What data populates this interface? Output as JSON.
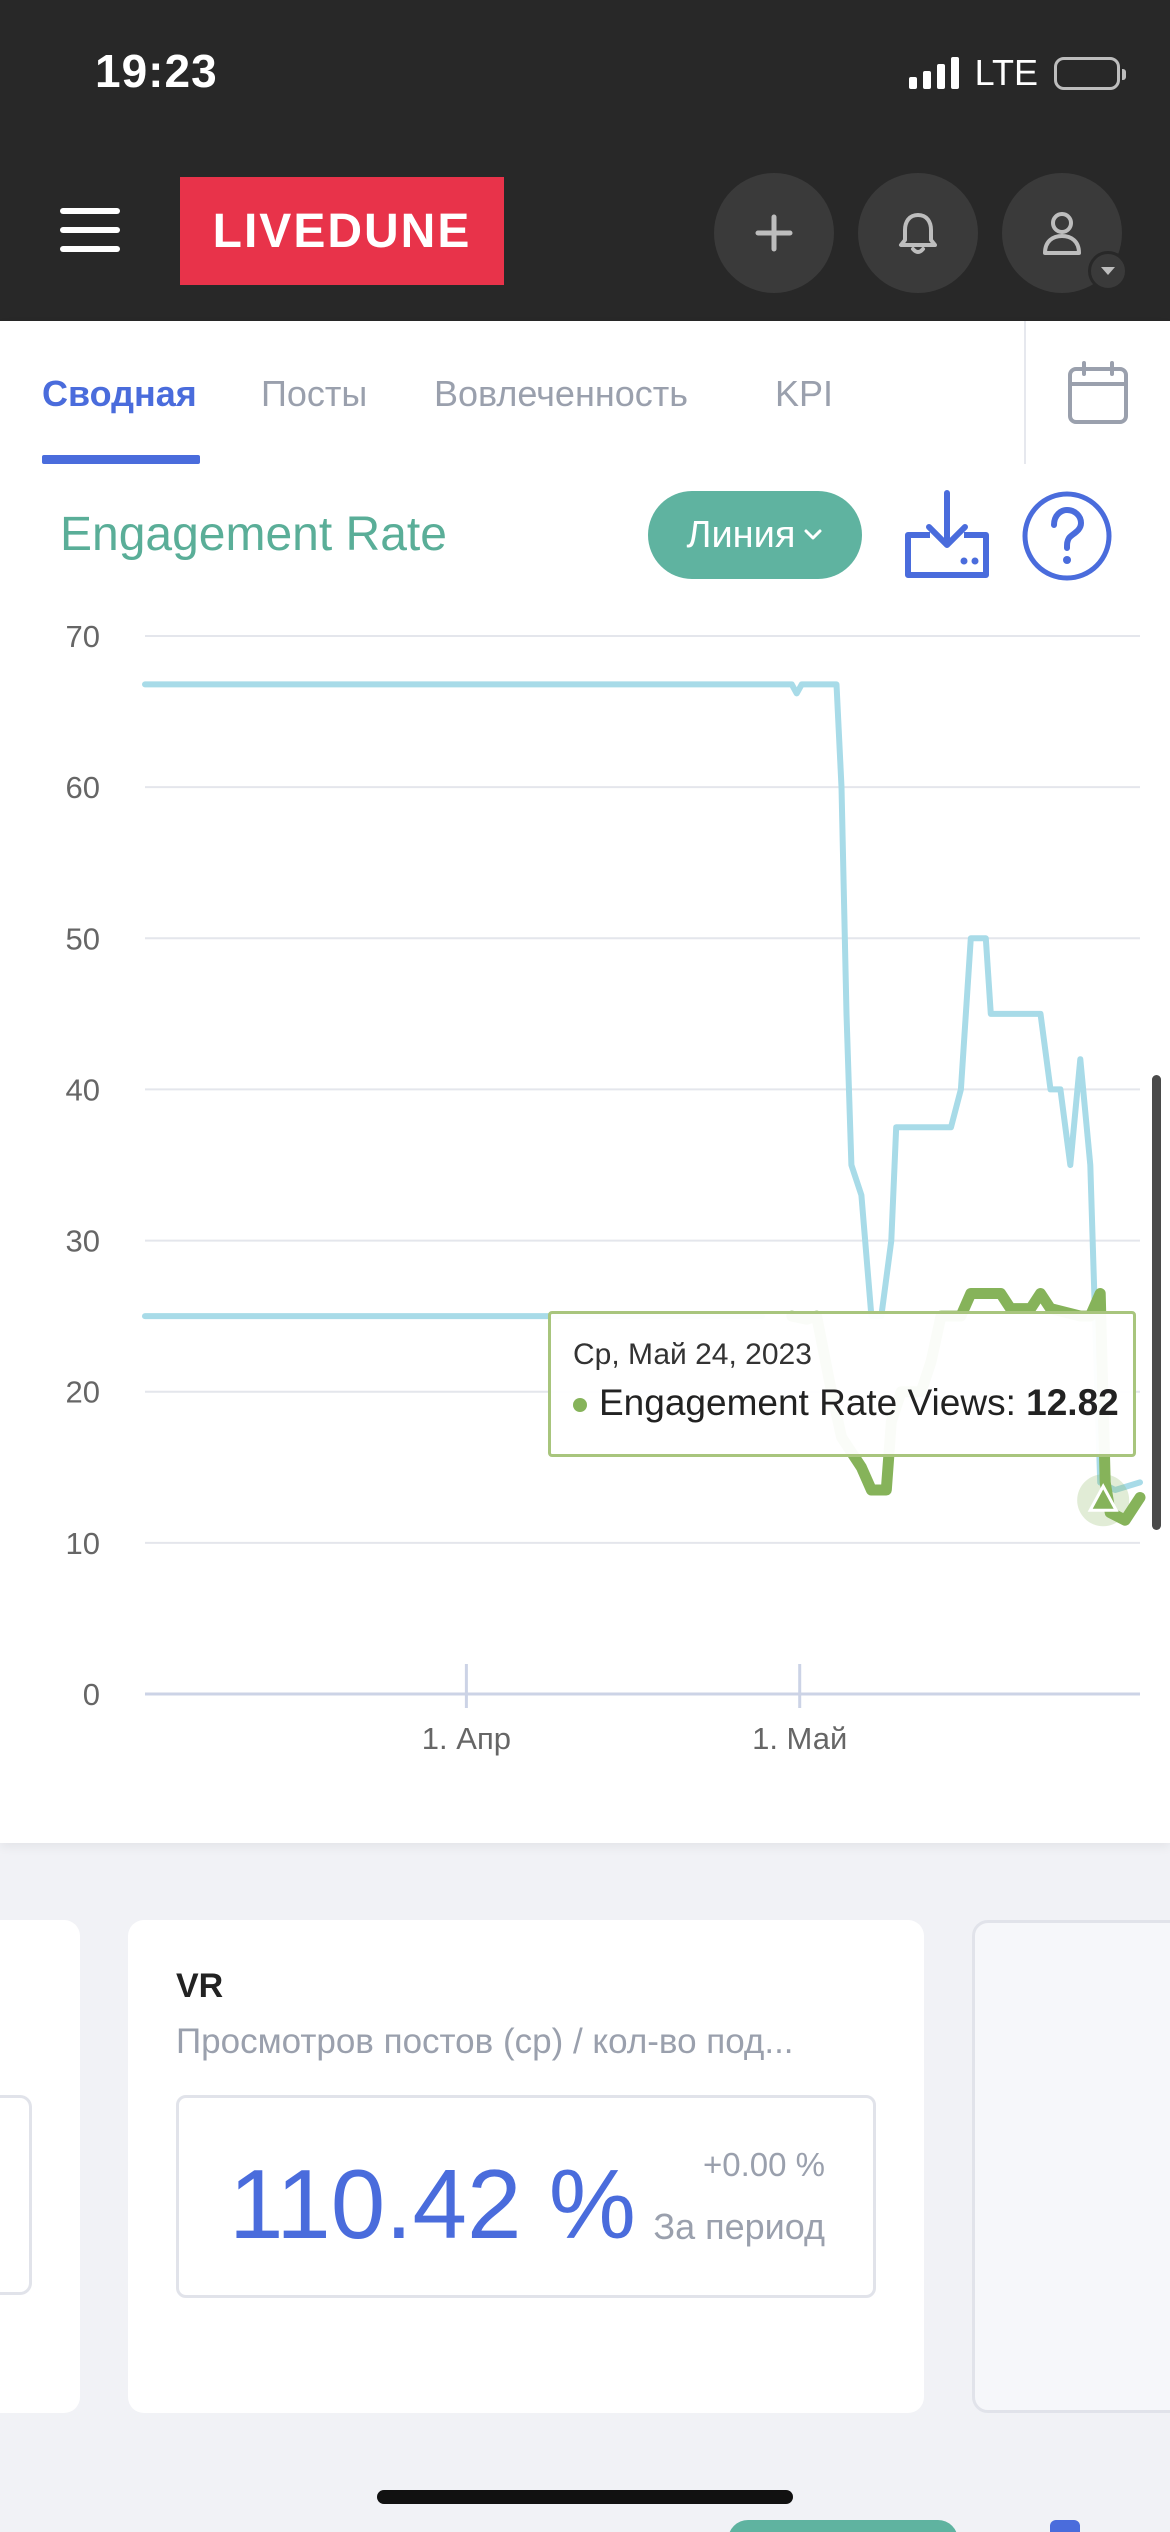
{
  "status_bar": {
    "time": "19:23",
    "network": "LTE"
  },
  "header": {
    "logo": "LIVEDUNE"
  },
  "tabs": [
    {
      "label": "Сводная",
      "active": true
    },
    {
      "label": "Посты",
      "active": false
    },
    {
      "label": "Вовлеченность",
      "active": false
    },
    {
      "label": "KPI",
      "active": false
    }
  ],
  "chart_panel": {
    "title": "Engagement Rate",
    "type_button": "Линия",
    "colors": {
      "series_1": "#a8dbe8",
      "series_2": "#86b35a",
      "accent": "#4a6cdc",
      "title": "#5aae98"
    }
  },
  "chart_data": {
    "type": "line",
    "ylim": [
      0,
      70
    ],
    "y_ticks": [
      "0",
      "10",
      "20",
      "30",
      "40",
      "50",
      "60",
      "70"
    ],
    "x_tick_labels": [
      "1. Апр",
      "1. Май"
    ],
    "grid": true,
    "series": [
      {
        "color": "#a8dbe8",
        "points": [
          [
            0,
            66.8
          ],
          [
            0.65,
            66.8
          ],
          [
            0.655,
            66.2
          ],
          [
            0.66,
            66.8
          ],
          [
            0.695,
            66.8
          ],
          [
            0.7,
            60
          ],
          [
            0.705,
            45
          ],
          [
            0.71,
            35
          ],
          [
            0.72,
            33
          ],
          [
            0.73,
            25
          ],
          [
            0.74,
            25
          ],
          [
            0.75,
            30
          ],
          [
            0.755,
            37.5
          ],
          [
            0.81,
            37.5
          ],
          [
            0.82,
            40
          ],
          [
            0.83,
            50
          ],
          [
            0.845,
            50
          ],
          [
            0.85,
            45
          ],
          [
            0.9,
            45
          ],
          [
            0.91,
            40
          ],
          [
            0.92,
            40
          ],
          [
            0.93,
            35
          ],
          [
            0.94,
            42
          ],
          [
            0.95,
            35
          ],
          [
            0.96,
            14
          ],
          [
            0.975,
            13.5
          ],
          [
            1.0,
            14
          ]
        ]
      },
      {
        "color": "#a8dbe8",
        "points": [
          [
            0,
            25
          ],
          [
            0.62,
            25
          ]
        ]
      },
      {
        "color": "#86b35a",
        "points": [
          [
            0.65,
            25
          ],
          [
            0.665,
            24.8
          ],
          [
            0.675,
            25
          ],
          [
            0.69,
            20
          ],
          [
            0.7,
            17
          ],
          [
            0.72,
            15
          ],
          [
            0.73,
            13.5
          ],
          [
            0.745,
            13.5
          ],
          [
            0.75,
            18
          ],
          [
            0.76,
            20
          ],
          [
            0.78,
            20
          ],
          [
            0.79,
            22
          ],
          [
            0.8,
            25
          ],
          [
            0.82,
            25
          ],
          [
            0.83,
            26.5
          ],
          [
            0.86,
            26.5
          ],
          [
            0.87,
            25.5
          ],
          [
            0.89,
            25.5
          ],
          [
            0.9,
            26.5
          ],
          [
            0.91,
            25.5
          ],
          [
            0.94,
            25
          ],
          [
            0.95,
            25
          ],
          [
            0.96,
            26.5
          ],
          [
            0.965,
            14
          ],
          [
            0.97,
            12
          ],
          [
            0.985,
            11.5
          ],
          [
            1.0,
            13
          ]
        ]
      }
    ],
    "tooltip": {
      "date": "Ср, Май 24, 2023",
      "series_label": "Engagement Rate Views:",
      "value": "12.82"
    }
  },
  "metric_card": {
    "title": "VR",
    "subtitle": "Просмотров постов (ср) / кол-во под...",
    "value": "110.42 %",
    "delta": "+0.00 %",
    "period": "За период"
  }
}
